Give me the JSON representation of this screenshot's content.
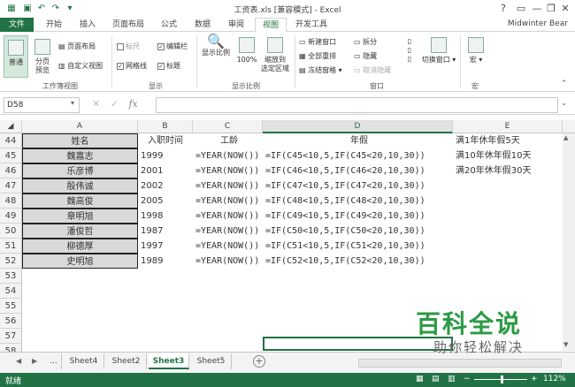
{
  "titlebar": {
    "title": "工资表.xls [兼容模式] - Excel",
    "min": "—",
    "restore": "❐",
    "close": "✕",
    "help": "?"
  },
  "tabs": [
    "文件",
    "开始",
    "插入",
    "页面布局",
    "公式",
    "数据",
    "审阅",
    "视图",
    "开发工具"
  ],
  "user": "Midwinter Bear",
  "ribbon": {
    "workbook_views": {
      "normal": "普通",
      "page_break": "分页\n预览",
      "page_layout": "页面布局",
      "custom": "自定义视图",
      "label": "工作簿视图"
    },
    "show": {
      "ruler": "标尺",
      "edit_bar": "编辑栏",
      "gridlines": "网格线",
      "headings": "标题",
      "label": "显示"
    },
    "zoom": {
      "zoom": "显示比例",
      "hundred": "100%",
      "to_sel": "缩放到\n选定区域",
      "label": "显示比例"
    },
    "window": {
      "new": "新建窗口",
      "arrange": "全部重排",
      "freeze": "冻结窗格",
      "split": "拆分",
      "hide": "隐藏",
      "unhide": "取消隐藏",
      "switch": "切换窗口",
      "label": "窗口"
    },
    "macro": {
      "macro": "宏",
      "label": "宏"
    }
  },
  "namebox": "D58",
  "fx": "fx",
  "columns": [
    "A",
    "B",
    "C",
    "D",
    "E"
  ],
  "rows": [
    {
      "n": "44",
      "a": "姓名",
      "b": "入职时间",
      "c": "工龄",
      "d": "年假",
      "e": "满1年休年假5天"
    },
    {
      "n": "45",
      "a": "魏嘉志",
      "b": "1999",
      "c": "=YEAR(NOW())",
      "d": "=IF(C45<10,5,IF(C45<20,10,30))",
      "e": "满10年休年假10天"
    },
    {
      "n": "46",
      "a": "乐彦博",
      "b": "2001",
      "c": "=YEAR(NOW())",
      "d": "=IF(C46<10,5,IF(C46<20,10,30))",
      "e": "满20年休年假30天"
    },
    {
      "n": "47",
      "a": "殷伟诚",
      "b": "2002",
      "c": "=YEAR(NOW())",
      "d": "=IF(C47<10,5,IF(C47<20,10,30))",
      "e": ""
    },
    {
      "n": "48",
      "a": "魏高俊",
      "b": "2005",
      "c": "=YEAR(NOW())",
      "d": "=IF(C48<10,5,IF(C48<20,10,30))",
      "e": ""
    },
    {
      "n": "49",
      "a": "章明旭",
      "b": "1998",
      "c": "=YEAR(NOW())",
      "d": "=IF(C49<10,5,IF(C49<20,10,30))",
      "e": ""
    },
    {
      "n": "50",
      "a": "潘俊哲",
      "b": "1987",
      "c": "=YEAR(NOW())",
      "d": "=IF(C50<10,5,IF(C50<20,10,30))",
      "e": ""
    },
    {
      "n": "51",
      "a": "柳德厚",
      "b": "1997",
      "c": "=YEAR(NOW())",
      "d": "=IF(C51<10,5,IF(C51<20,10,30))",
      "e": ""
    },
    {
      "n": "52",
      "a": "史明旭",
      "b": "1989",
      "c": "=YEAR(NOW())",
      "d": "=IF(C52<10,5,IF(C52<20,10,30))",
      "e": ""
    },
    {
      "n": "53",
      "a": "",
      "b": "",
      "c": "",
      "d": "",
      "e": ""
    },
    {
      "n": "54",
      "a": "",
      "b": "",
      "c": "",
      "d": "",
      "e": ""
    },
    {
      "n": "55",
      "a": "",
      "b": "",
      "c": "",
      "d": "",
      "e": ""
    },
    {
      "n": "56",
      "a": "",
      "b": "",
      "c": "",
      "d": "",
      "e": ""
    },
    {
      "n": "57",
      "a": "",
      "b": "",
      "c": "",
      "d": "",
      "e": ""
    },
    {
      "n": "58",
      "a": "",
      "b": "",
      "c": "",
      "d": "",
      "e": ""
    }
  ],
  "sheets": [
    "Sheet4",
    "Sheet2",
    "Sheet3",
    "Sheet5"
  ],
  "sheet_ellipsis": "...",
  "add_sheet": "+",
  "status": {
    "ready": "就绪",
    "zoom": "112%"
  },
  "watermark": {
    "title": "百科全说",
    "subtitle": "助你轻松解决"
  },
  "colors": {
    "accent": "#217346",
    "name_fill": "#d9d9d9"
  }
}
